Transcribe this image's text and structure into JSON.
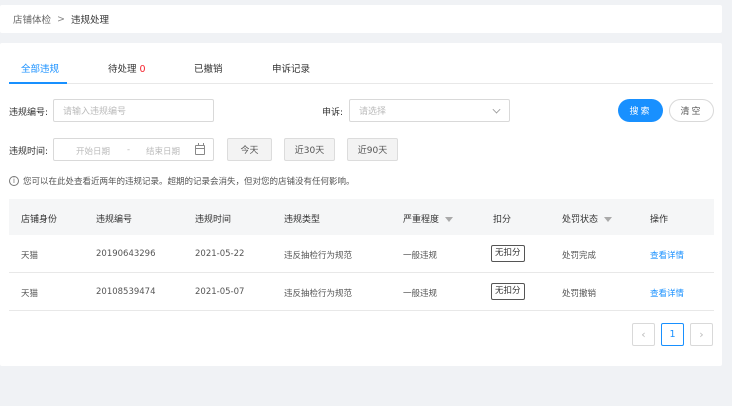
{
  "breadcrumb": {
    "parent": "店铺体检",
    "separator": ">",
    "current": "违规处理"
  },
  "tabs": [
    {
      "label": "全部违规",
      "count": ""
    },
    {
      "label": "待处理",
      "count": "0"
    },
    {
      "label": "已撤销",
      "count": ""
    },
    {
      "label": "申诉记录",
      "count": ""
    }
  ],
  "filters": {
    "violation_no_label": "违规编号:",
    "violation_no_placeholder": "请输入违规编号",
    "appeal_label": "申诉:",
    "appeal_placeholder": "请选择",
    "time_label": "违规时间:",
    "start_placeholder": "开始日期",
    "range_sep": "-",
    "end_placeholder": "结束日期",
    "quick": [
      "今天",
      "近30天",
      "近90天"
    ],
    "search_label": "搜索",
    "clear_label": "清空"
  },
  "notice": "您可以在此处查看近两年的违规记录。超期的记录会消失，但对您的店铺没有任何影响。",
  "table": {
    "columns": [
      "店铺身份",
      "违规编号",
      "违规时间",
      "违规类型",
      "严重程度",
      "扣分",
      "处罚状态",
      "操作"
    ],
    "rows": [
      {
        "identity": "天猫",
        "id": "20190643296",
        "time": "2021-05-22",
        "type": "违反抽检行为规范",
        "severity": "一般违规",
        "points": "无扣分",
        "status": "处罚完成",
        "action": "查看详情"
      },
      {
        "identity": "天猫",
        "id": "20108539474",
        "time": "2021-05-07",
        "type": "违反抽检行为规范",
        "severity": "一般违规",
        "points": "无扣分",
        "status": "处罚撤销",
        "action": "查看详情"
      }
    ]
  },
  "pagination": {
    "current": "1",
    "prev": "‹",
    "next": "›"
  }
}
